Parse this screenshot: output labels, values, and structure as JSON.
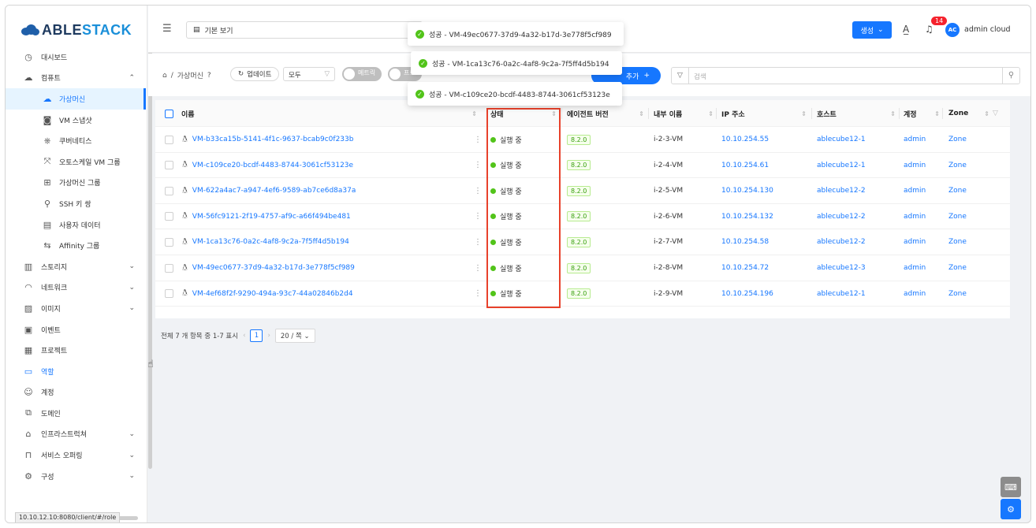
{
  "app": {
    "brand_part1": "ABLE",
    "brand_part2": "STACK"
  },
  "sidebar": {
    "items": [
      {
        "label": "대시보드",
        "icon": "dashboard-icon"
      },
      {
        "label": "컴퓨트",
        "icon": "cloud-icon",
        "chevron": "⌃"
      },
      {
        "label": "가상머신",
        "icon": "vm-cloud-icon"
      },
      {
        "label": "VM 스냅샷",
        "icon": "camera-icon"
      },
      {
        "label": "쿠버네티스",
        "icon": "kubernetes-icon"
      },
      {
        "label": "오토스케일 VM 그룹",
        "icon": "autoscale-icon"
      },
      {
        "label": "가상머신 그룹",
        "icon": "group-icon"
      },
      {
        "label": "SSH 키 쌍",
        "icon": "key-icon"
      },
      {
        "label": "사용자 데이터",
        "icon": "user-data-icon"
      },
      {
        "label": "Affinity 그룹",
        "icon": "affinity-icon"
      },
      {
        "label": "스토리지",
        "icon": "storage-icon",
        "chevron": "⌄"
      },
      {
        "label": "네트워크",
        "icon": "wifi-icon",
        "chevron": "⌄"
      },
      {
        "label": "이미지",
        "icon": "image-icon",
        "chevron": "⌄"
      },
      {
        "label": "이벤트",
        "icon": "calendar-icon"
      },
      {
        "label": "프로젝트",
        "icon": "project-icon"
      },
      {
        "label": "역할",
        "icon": "role-icon"
      },
      {
        "label": "계정",
        "icon": "account-icon"
      },
      {
        "label": "도메인",
        "icon": "domain-icon"
      },
      {
        "label": "인프라스트럭쳐",
        "icon": "bank-icon",
        "chevron": "⌄"
      },
      {
        "label": "서비스 오퍼링",
        "icon": "shopping-icon",
        "chevron": "⌄"
      },
      {
        "label": "구성",
        "icon": "settings-icon",
        "chevron": "⌄"
      }
    ],
    "status_url": "10.10.12.10:8080/client/#/role"
  },
  "header": {
    "view_label": "기본 보기",
    "create_label": "생성",
    "notification_count": "14",
    "avatar_initials": "AC",
    "user_name": "admin cloud"
  },
  "toolbar": {
    "breadcrumb_page": "가상머신",
    "refresh_label": "업데이트",
    "filter_value": "모두",
    "toggle1_label": "메트릭",
    "toggle2_label": "프로",
    "add_label": "추가",
    "search_placeholder": "검색"
  },
  "table": {
    "columns": [
      "이름",
      "상태",
      "에이전트 버전",
      "내부 이름",
      "IP 주소",
      "호스트",
      "계정",
      "Zone"
    ],
    "rows": [
      {
        "name": "VM-b33ca15b-5141-4f1c-9637-bcab9c0f233b",
        "state": "실행 중",
        "agent": "8.2.0",
        "internal": "i-2-3-VM",
        "ip": "10.10.254.55",
        "host": "ablecube12-1",
        "account": "admin",
        "zone": "Zone"
      },
      {
        "name": "VM-c109ce20-bcdf-4483-8744-3061cf53123e",
        "state": "실행 중",
        "agent": "8.2.0",
        "internal": "i-2-4-VM",
        "ip": "10.10.254.61",
        "host": "ablecube12-1",
        "account": "admin",
        "zone": "Zone"
      },
      {
        "name": "VM-622a4ac7-a947-4ef6-9589-ab7ce6d8a37a",
        "state": "실행 중",
        "agent": "8.2.0",
        "internal": "i-2-5-VM",
        "ip": "10.10.254.130",
        "host": "ablecube12-2",
        "account": "admin",
        "zone": "Zone"
      },
      {
        "name": "VM-56fc9121-2f19-4757-af9c-a66f494be481",
        "state": "실행 중",
        "agent": "8.2.0",
        "internal": "i-2-6-VM",
        "ip": "10.10.254.132",
        "host": "ablecube12-2",
        "account": "admin",
        "zone": "Zone"
      },
      {
        "name": "VM-1ca13c76-0a2c-4af8-9c2a-7f5ff4d5b194",
        "state": "실행 중",
        "agent": "8.2.0",
        "internal": "i-2-7-VM",
        "ip": "10.10.254.58",
        "host": "ablecube12-2",
        "account": "admin",
        "zone": "Zone"
      },
      {
        "name": "VM-49ec0677-37d9-4a32-b17d-3e778f5cf989",
        "state": "실행 중",
        "agent": "8.2.0",
        "internal": "i-2-8-VM",
        "ip": "10.10.254.72",
        "host": "ablecube12-3",
        "account": "admin",
        "zone": "Zone"
      },
      {
        "name": "VM-4ef68f2f-9290-494a-93c7-44a02846b2d4",
        "state": "실행 중",
        "agent": "8.2.0",
        "internal": "i-2-9-VM",
        "ip": "10.10.254.196",
        "host": "ablecube12-1",
        "account": "admin",
        "zone": "Zone"
      }
    ]
  },
  "pagination": {
    "summary": "전체 7 개 항목 중 1-7 표시",
    "current_page": "1",
    "page_size": "20 / 쪽"
  },
  "toasts": [
    {
      "text": "성공 - VM-49ec0677-37d9-4a32-b17d-3e778f5cf989"
    },
    {
      "text": "성공 - VM-1ca13c76-0a2c-4af8-9c2a-7f5ff4d5b194"
    },
    {
      "text": "성공 - VM-c109ce20-bcdf-4483-8744-3061cf53123e"
    }
  ],
  "colors": {
    "accent": "#1677ff",
    "success": "#52c41a",
    "highlight_box": "#e8412b"
  }
}
